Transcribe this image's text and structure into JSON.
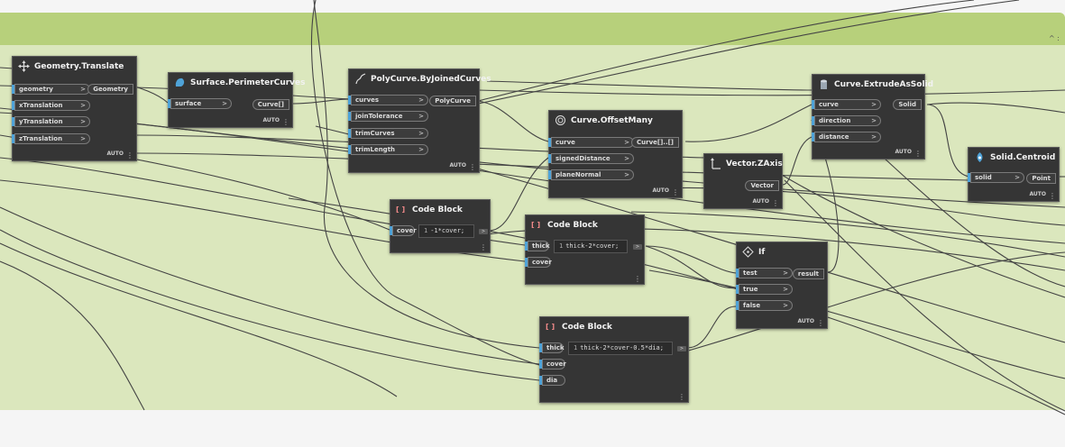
{
  "group": {
    "collapse_icon": "^ :"
  },
  "nodes": {
    "geometry_translate": {
      "title": "Geometry.Translate",
      "icon": "move-icon",
      "inputs": [
        "geometry",
        "xTranslation",
        "yTranslation",
        "zTranslation"
      ],
      "output": "Geometry",
      "auto": "AUTO"
    },
    "surface_perimeter": {
      "title": "Surface.PerimeterCurves",
      "icon": "surface-icon",
      "inputs": [
        "surface"
      ],
      "output": "Curve[]",
      "auto": "AUTO"
    },
    "polycurve": {
      "title": "PolyCurve.ByJoinedCurves",
      "icon": "polycurve-icon",
      "inputs": [
        "curves",
        "joinTolerance",
        "trimCurves",
        "trimLength"
      ],
      "output": "PolyCurve",
      "auto": "AUTO"
    },
    "offset_many": {
      "title": "Curve.OffsetMany",
      "icon": "offset-icon",
      "inputs": [
        "curve",
        "signedDistance",
        "planeNormal"
      ],
      "output": "Curve[]..[]",
      "auto": "AUTO"
    },
    "vector_zaxis": {
      "title": "Vector.ZAxis",
      "icon": "axis-icon",
      "output": "Vector",
      "auto": "AUTO"
    },
    "extrude": {
      "title": "Curve.ExtrudeAsSolid",
      "icon": "extrude-icon",
      "inputs": [
        "curve",
        "direction",
        "distance"
      ],
      "output": "Solid",
      "auto": "AUTO"
    },
    "centroid": {
      "title": "Solid.Centroid",
      "icon": "centroid-icon",
      "inputs": [
        "solid"
      ],
      "output": "Point",
      "auto": "AUTO"
    },
    "code1": {
      "title": "Code Block",
      "icon": "code-block-icon",
      "inputs": [
        "cover"
      ],
      "line": "1",
      "code": "-1*cover;"
    },
    "code2": {
      "title": "Code Block",
      "icon": "code-block-icon",
      "inputs": [
        "thick",
        "cover"
      ],
      "line": "1",
      "code": "thick-2*cover;"
    },
    "code3": {
      "title": "Code Block",
      "icon": "code-block-icon",
      "inputs": [
        "thick",
        "cover",
        "dia"
      ],
      "line": "1",
      "code": "thick-2*cover-0.5*dia;"
    },
    "if_node": {
      "title": "If",
      "icon": "if-icon",
      "inputs": [
        "test",
        "true",
        "false"
      ],
      "output": "result",
      "auto": "AUTO"
    }
  }
}
